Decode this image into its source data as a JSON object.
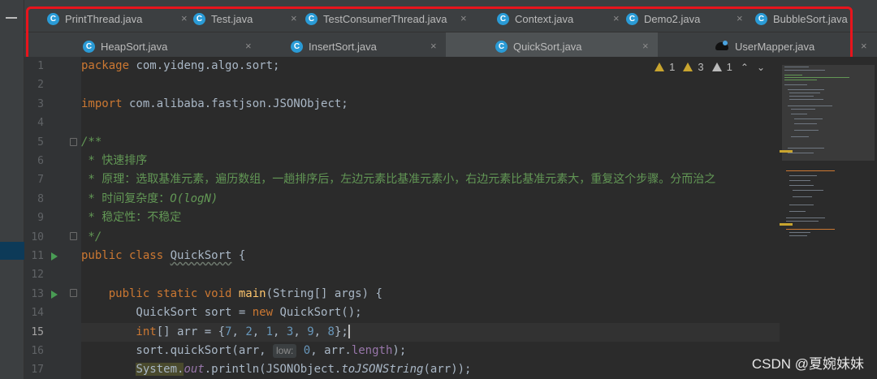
{
  "tabs": {
    "row1": [
      {
        "label": "PrintThread.java",
        "close": "×"
      },
      {
        "label": "Test.java",
        "close": "×"
      },
      {
        "label": "TestConsumerThread.java",
        "close": "×"
      },
      {
        "label": "Context.java",
        "close": "×"
      },
      {
        "label": "Demo2.java",
        "close": "×"
      },
      {
        "label": "BubbleSort.java",
        "close": "×"
      }
    ],
    "row2": [
      {
        "label": "HeapSort.java",
        "close": "×"
      },
      {
        "label": "InsertSort.java",
        "close": "×"
      },
      {
        "label": "QuickSort.java",
        "close": "×"
      },
      {
        "label": "UserMapper.java",
        "close": "×"
      }
    ],
    "class_icon_letter": "C",
    "active": "QuickSort.java"
  },
  "editor": {
    "line_numbers": [
      "1",
      "2",
      "3",
      "4",
      "5",
      "6",
      "7",
      "8",
      "9",
      "10",
      "11",
      "12",
      "13",
      "14",
      "15",
      "16",
      "17"
    ],
    "current_line": "15",
    "inspections": {
      "warnings_a": "1",
      "warnings_b": "3",
      "errors": "1",
      "up": "⌃",
      "down": "⌄"
    },
    "code": {
      "l1_kw": "package",
      "l1_rest": " com.yideng.algo.sort;",
      "l3_kw": "import",
      "l3_rest": " com.alibaba.fastjson.JSONObject;",
      "l5": "/**",
      "l6": " * 快速排序",
      "l7": " * 原理：选取基准元素，遍历数组，一趟排序后，左边元素比基准元素小，右边元素比基准元素大，重复这个步骤。分而治之",
      "l8_a": " * 时间复杂度：",
      "l8_b": "O(logN)",
      "l9": " * 稳定性：不稳定",
      "l10": " */",
      "l11_kw": "public class ",
      "l11_name": "QuickSort",
      "l11_rest": " {",
      "l13_kw": "    public static void ",
      "l13_fn": "main",
      "l13_rest": "(String[] args) {",
      "l14_a": "        QuickSort sort = ",
      "l14_kw": "new",
      "l14_b": " QuickSort();",
      "l15_kw": "        int",
      "l15_a": "[] arr = {",
      "l15_n1": "7",
      "l15_n2": "2",
      "l15_n3": "1",
      "l15_n4": "3",
      "l15_n5": "9",
      "l15_n6": "8",
      "l15_b": "};",
      "sep": ", ",
      "l16_a": "        sort.quickSort(arr, ",
      "l16_hint": "low:",
      "l16_n": "0",
      "l16_b": ", arr.",
      "l16_fld": "length",
      "l16_c": ");",
      "l17_ind": "        ",
      "l17_sys": "System.",
      "l17_out": "out",
      "l17_a": ".println(JSONObject.",
      "l17_fn": "toJSONString",
      "l17_b": "(arr));"
    }
  },
  "watermark": "CSDN @夏婉妹妹",
  "colors": {
    "highlight_box": "#e8141c",
    "accent": "#4a88c7",
    "class_icon": "#2a9bd6"
  }
}
